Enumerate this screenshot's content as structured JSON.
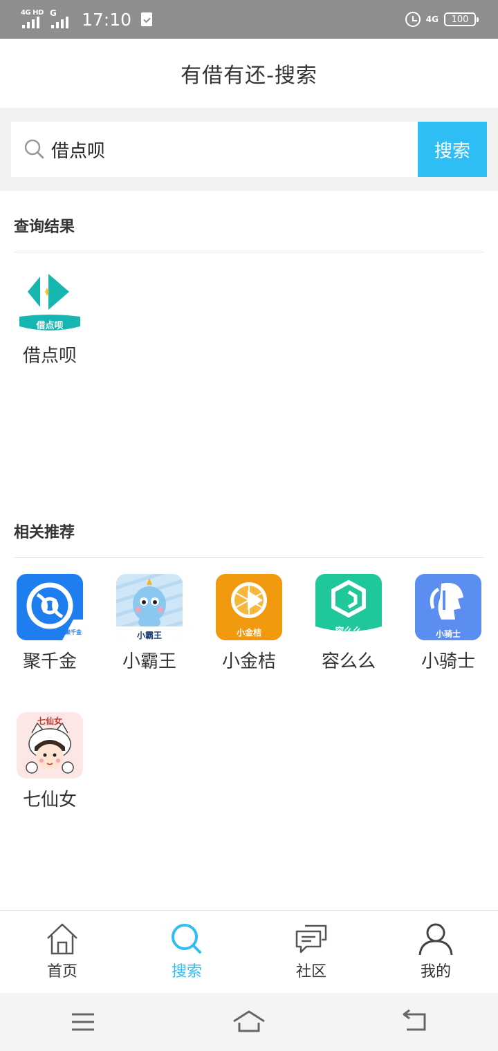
{
  "status_bar": {
    "network_left": "4G HD",
    "network_left2": "G",
    "time": "17:10",
    "network_right": "4G",
    "battery": "100"
  },
  "header": {
    "title": "有借有还-搜索"
  },
  "search": {
    "value": "借点呗",
    "button_label": "搜索"
  },
  "results": {
    "title": "查询结果",
    "items": [
      {
        "name": "借点呗",
        "icon": "jiedianbei-app-icon",
        "badge": "借点呗"
      }
    ]
  },
  "recommend": {
    "title": "相关推荐",
    "items": [
      {
        "name": "聚千金",
        "icon": "juqianjin-app-icon",
        "badge": "聚千金"
      },
      {
        "name": "小霸王",
        "icon": "xiaobawang-app-icon",
        "badge": "小霸王"
      },
      {
        "name": "小金桔",
        "icon": "xiaojinju-app-icon",
        "badge": "小金桔"
      },
      {
        "name": "容么么",
        "icon": "rongmeme-app-icon",
        "badge": "容么么"
      },
      {
        "name": "小骑士",
        "icon": "xiaoqishi-app-icon",
        "badge": "小骑士"
      },
      {
        "name": "七仙女",
        "icon": "qixiannv-app-icon",
        "badge": "七仙女"
      }
    ]
  },
  "bottom_nav": [
    {
      "label": "首页",
      "icon": "home-icon"
    },
    {
      "label": "搜索",
      "icon": "search-icon",
      "active": true
    },
    {
      "label": "社区",
      "icon": "chat-bubbles-icon"
    },
    {
      "label": "我的",
      "icon": "person-icon"
    }
  ],
  "colors": {
    "accent": "#2fbdf5",
    "status_bar": "#8e8e8e",
    "search_bg": "#f2f2f2"
  }
}
